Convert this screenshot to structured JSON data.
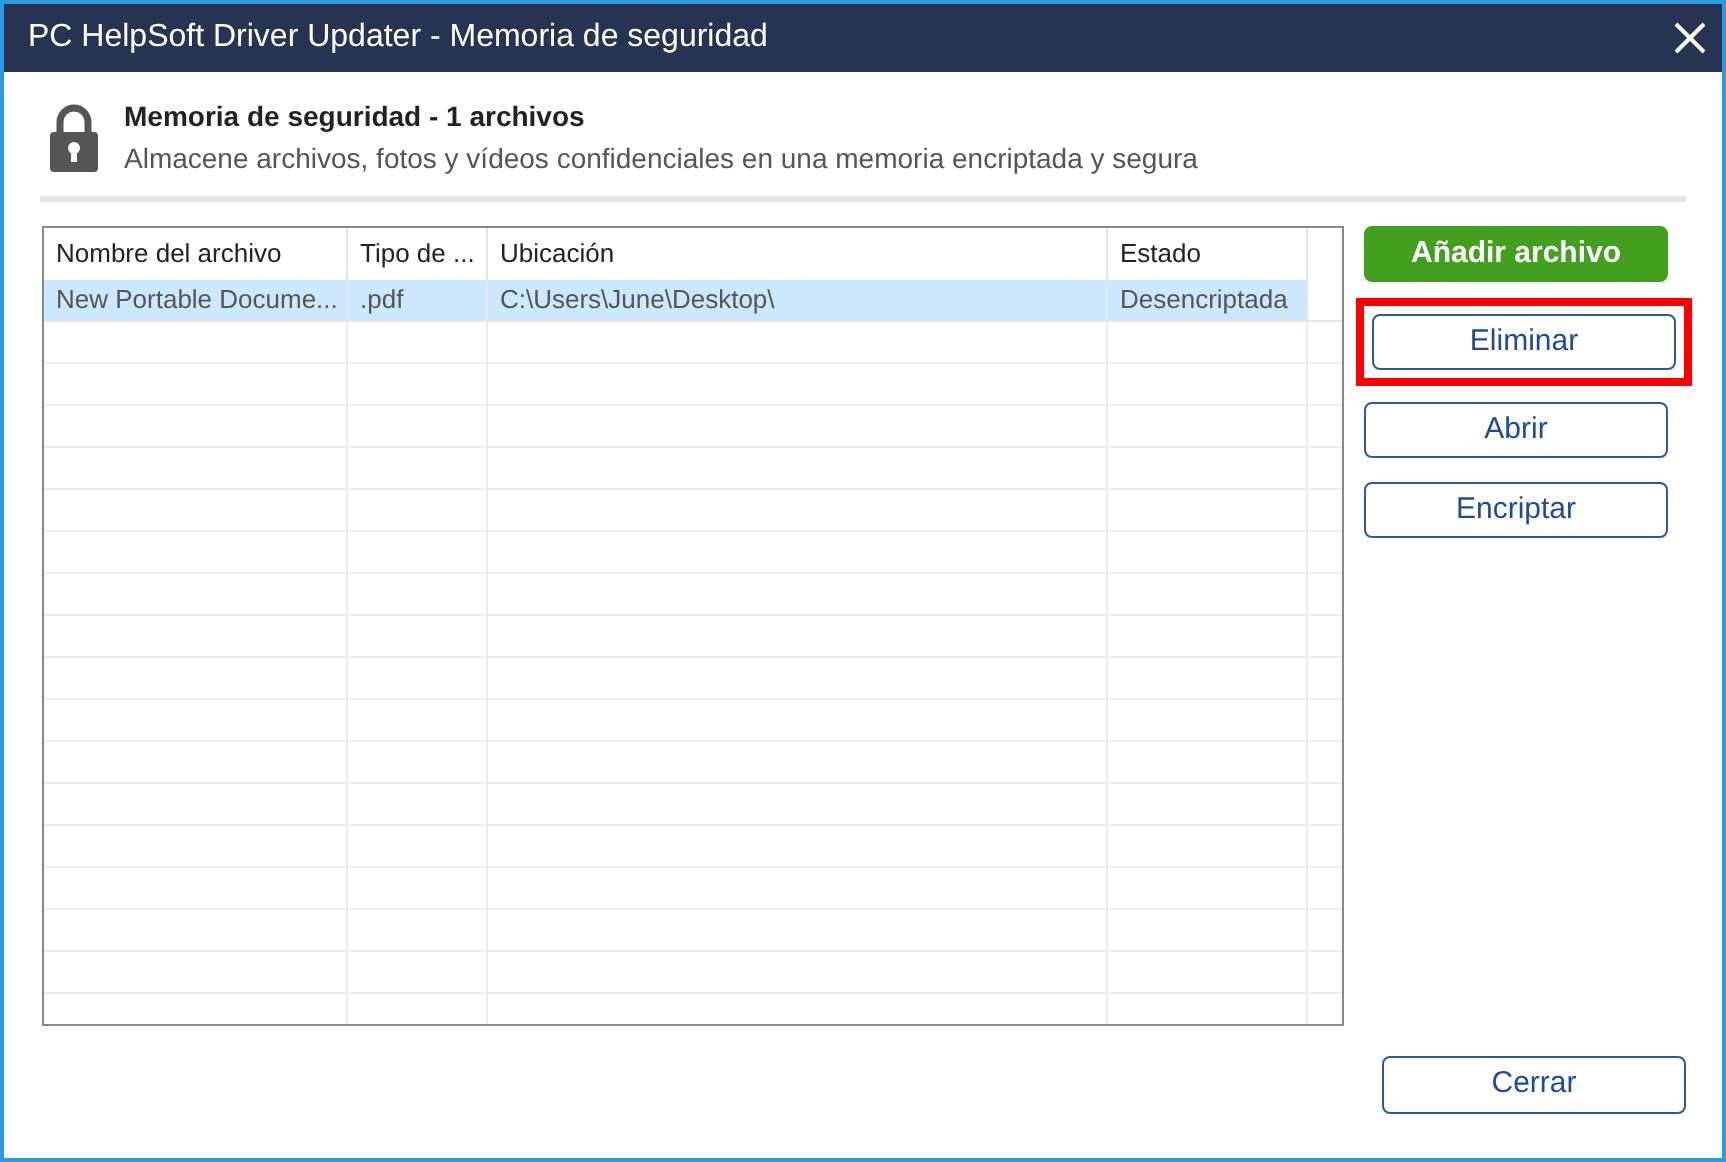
{
  "window": {
    "title": "PC HelpSoft Driver Updater - Memoria de seguridad"
  },
  "header": {
    "title": "Memoria de seguridad - 1 archivos",
    "subtitle": "Almacene archivos, fotos y vídeos confidenciales en una memoria encriptada y segura"
  },
  "table": {
    "columns": [
      "Nombre del archivo",
      "Tipo de ...",
      "Ubicación",
      "Estado"
    ],
    "rows": [
      {
        "cells": [
          "New Portable Docume...",
          ".pdf",
          "C:\\Users\\June\\Desktop\\",
          "Desencriptada"
        ],
        "selected": true
      }
    ]
  },
  "buttons": [
    {
      "label": "Añadir archivo",
      "kind": "primary",
      "highlighted": false
    },
    {
      "label": "Eliminar",
      "kind": "outline",
      "highlighted": true
    },
    {
      "label": "Abrir",
      "kind": "outline",
      "highlighted": false
    },
    {
      "label": "Encriptar",
      "kind": "outline",
      "highlighted": false
    }
  ],
  "close_button": {
    "label": "Cerrar"
  }
}
